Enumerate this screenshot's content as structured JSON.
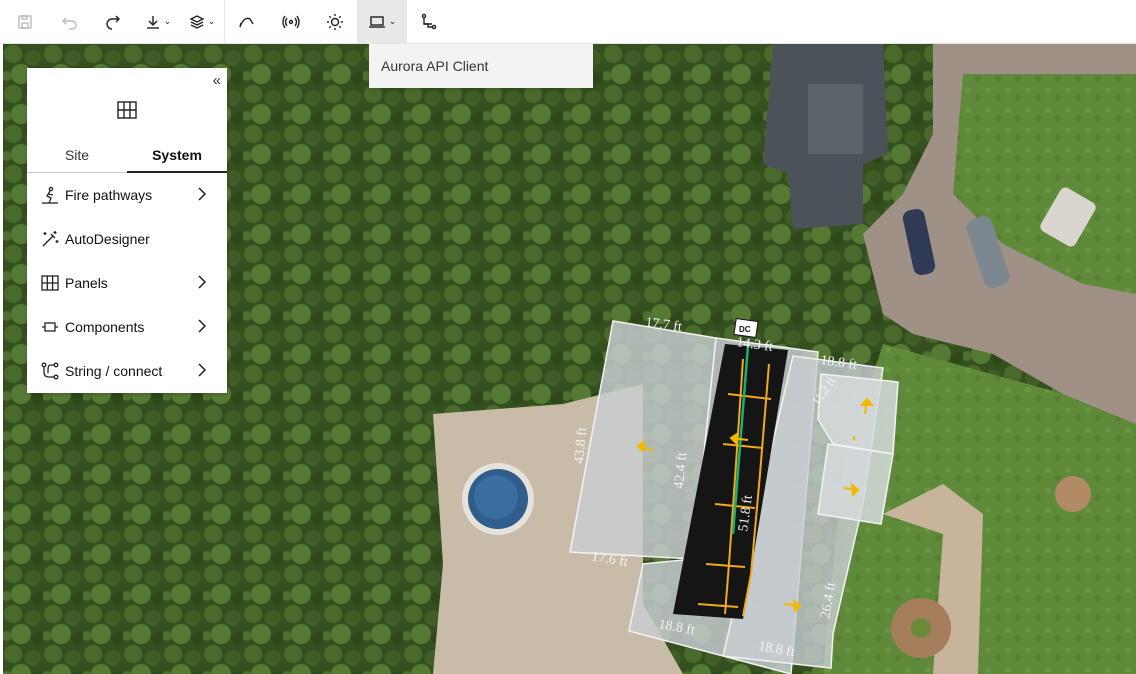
{
  "toolbar": {
    "buttons": [
      {
        "name": "save-icon",
        "disabled": true
      },
      {
        "name": "undo-icon",
        "disabled": true
      },
      {
        "name": "redo-icon",
        "disabled": false
      },
      {
        "name": "download-icon",
        "disabled": false,
        "dropdown": true
      },
      {
        "name": "layers-icon",
        "disabled": false,
        "dropdown": true
      },
      {
        "name": "shade-icon",
        "disabled": false
      },
      {
        "name": "broadcast-icon",
        "disabled": false
      },
      {
        "name": "sun-icon",
        "disabled": false
      },
      {
        "name": "laptop-icon",
        "disabled": false,
        "dropdown": true,
        "active": true
      },
      {
        "name": "route-icon",
        "disabled": false
      }
    ]
  },
  "dropdown": {
    "item": "Aurora API Client"
  },
  "panel": {
    "tabs": [
      {
        "label": "Site",
        "active": false
      },
      {
        "label": "System",
        "active": true
      }
    ],
    "items": [
      {
        "label": "Fire pathways",
        "icon": "fire-pathway-icon",
        "submenu": true
      },
      {
        "label": "AutoDesigner",
        "icon": "magic-wand-icon",
        "submenu": false
      },
      {
        "label": "Panels",
        "icon": "panels-grid-icon",
        "submenu": true
      },
      {
        "label": "Components",
        "icon": "component-icon",
        "submenu": true
      },
      {
        "label": "String / connect",
        "icon": "string-connect-icon",
        "submenu": true
      }
    ]
  },
  "map": {
    "dc_label": "DC",
    "dimensions": [
      "17.7 ft",
      "14.3 ft",
      "18.8 ft",
      "11.2 ft",
      "43.8 ft",
      "42.4 ft",
      "51.8 ft",
      "17.6 ft",
      "18.8 ft",
      "18.8 ft",
      "26.4 ft"
    ],
    "colors": {
      "roof": "#c9ced3",
      "panel": "#161616",
      "string": "#f2a91c",
      "conduit": "#1bb06d",
      "arrow": "#f5b800"
    }
  }
}
